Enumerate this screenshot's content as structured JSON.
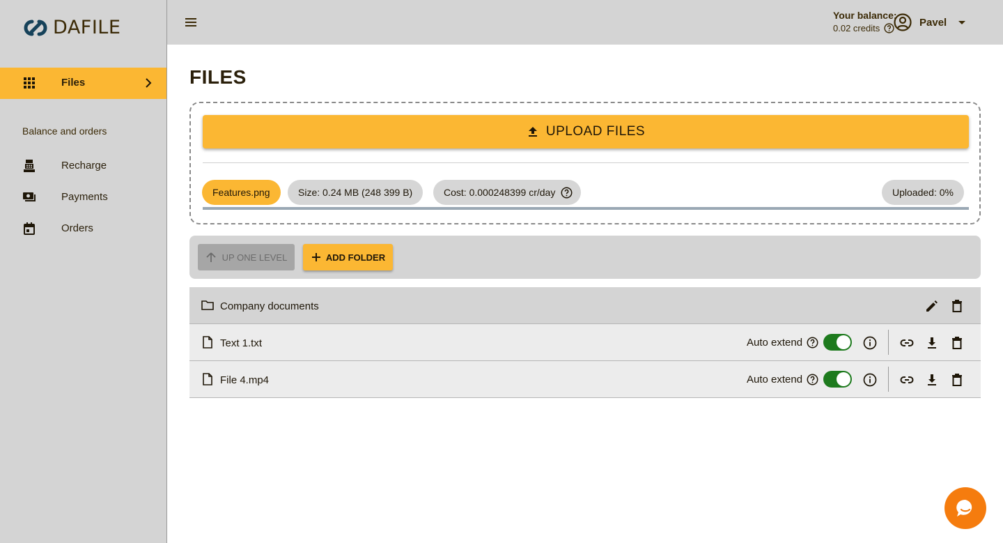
{
  "brand": {
    "name": "DAFILE"
  },
  "sidebar": {
    "files_label": "Files",
    "section_title": "Balance and orders",
    "items": [
      {
        "label": "Recharge",
        "icon": "register-icon"
      },
      {
        "label": "Payments",
        "icon": "payments-icon"
      },
      {
        "label": "Orders",
        "icon": "calendar-icon"
      }
    ]
  },
  "header": {
    "balance_title": "Your balance:",
    "balance_value": "0.02 credits",
    "user_name": "Pavel"
  },
  "main": {
    "title": "FILES",
    "upload_label": "UPLOAD FILES",
    "upload": {
      "file_name": "Features.png",
      "size": "Size: 0.24 MB (248 399 B)",
      "cost": "Cost: 0.000248399 cr/day",
      "uploaded": "Uploaded: 0%",
      "progress_percent": 0
    },
    "toolbar": {
      "up_label": "UP ONE LEVEL",
      "add_folder_label": "ADD FOLDER"
    },
    "rows": [
      {
        "type": "folder",
        "name": "Company documents"
      },
      {
        "type": "file",
        "name": "Text 1.txt",
        "auto_extend_label": "Auto extend",
        "auto_extend": true
      },
      {
        "type": "file",
        "name": "File 4.mp4",
        "auto_extend_label": "Auto extend",
        "auto_extend": true
      }
    ]
  },
  "colors": {
    "accent": "#fbb733",
    "sidebar_bg": "#d4d4d4",
    "toggle_on": "#1d7a1d",
    "chat": "#f57c0e"
  }
}
